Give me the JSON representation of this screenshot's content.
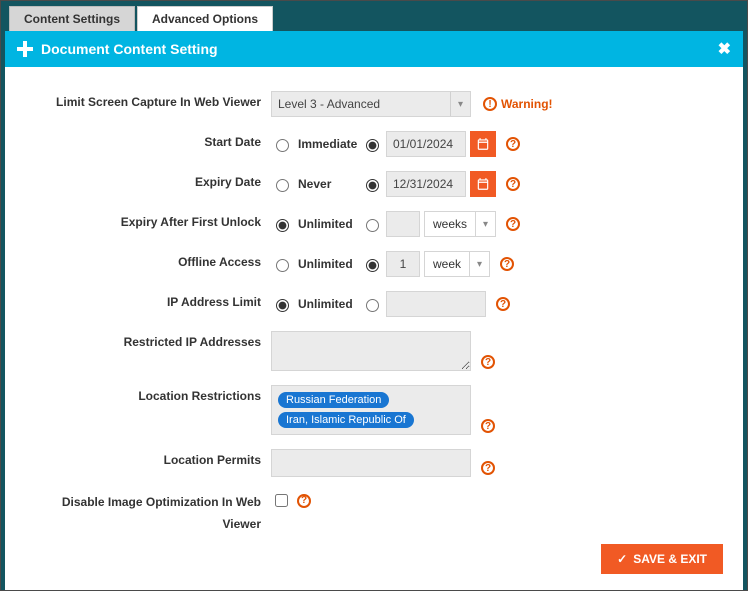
{
  "tabs": {
    "content_settings": "Content Settings",
    "advanced_options": "Advanced Options"
  },
  "header": {
    "title": "Document Content Setting"
  },
  "form": {
    "screen_capture": {
      "label": "Limit Screen Capture In Web Viewer",
      "selected": "Level 3 - Advanced",
      "warning": "Warning!"
    },
    "start_date": {
      "label": "Start Date",
      "option_immediate": "Immediate",
      "value": "01/01/2024"
    },
    "expiry_date": {
      "label": "Expiry Date",
      "option_never": "Never",
      "value": "12/31/2024"
    },
    "expiry_after_unlock": {
      "label": "Expiry After First Unlock",
      "option_unlimited": "Unlimited",
      "num": "",
      "unit": "weeks"
    },
    "offline_access": {
      "label": "Offline Access",
      "option_unlimited": "Unlimited",
      "num": "1",
      "unit": "week"
    },
    "ip_limit": {
      "label": "IP Address Limit",
      "option_unlimited": "Unlimited"
    },
    "restricted_ip": {
      "label": "Restricted IP Addresses"
    },
    "location_restrictions": {
      "label": "Location Restrictions",
      "tags": [
        "Russian Federation",
        "Iran, Islamic Republic Of"
      ]
    },
    "location_permits": {
      "label": "Location Permits"
    },
    "disable_image_opt": {
      "label": "Disable Image Optimization In Web Viewer"
    }
  },
  "footer": {
    "save_exit": "SAVE & EXIT"
  }
}
